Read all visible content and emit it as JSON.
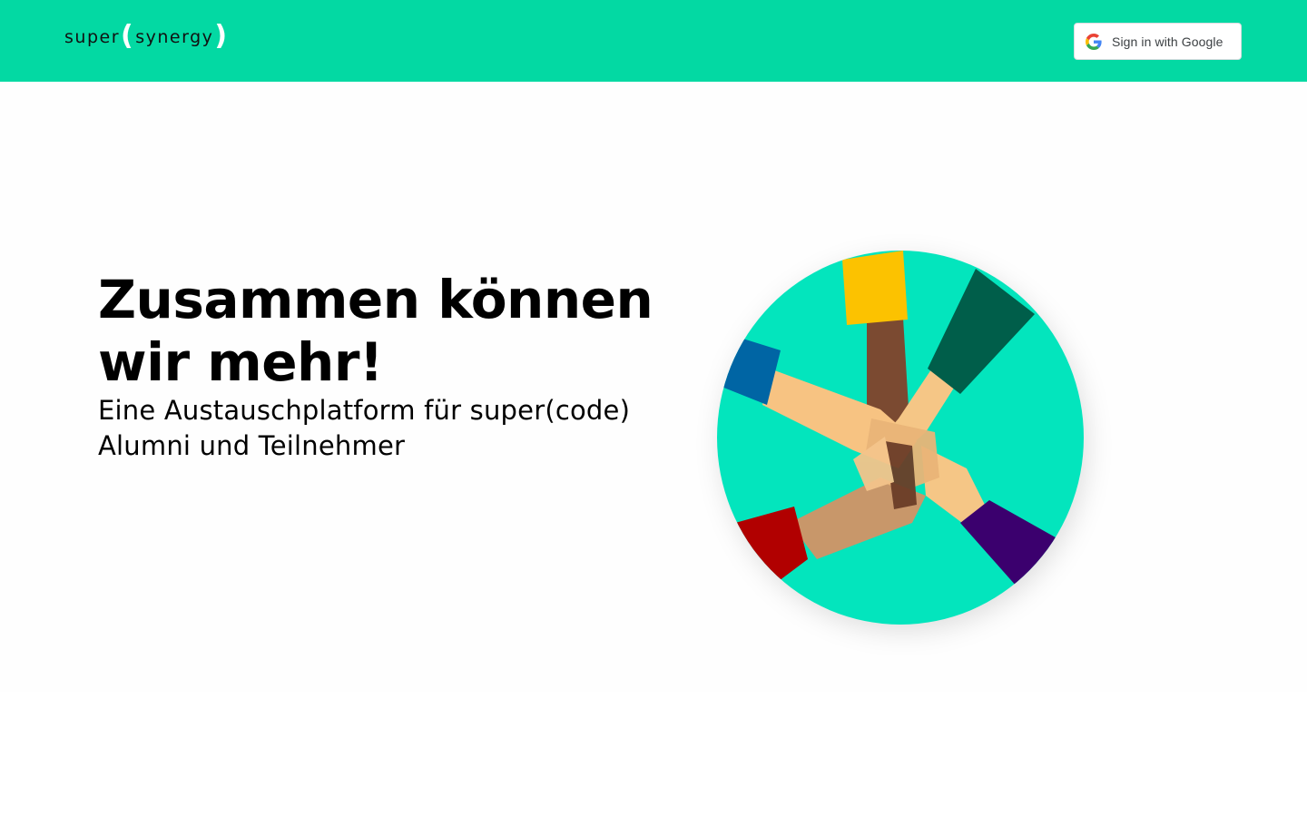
{
  "header": {
    "logo": {
      "part1": "super",
      "paren_open": "(",
      "part2": "synergy",
      "paren_close": ")"
    },
    "google_button": {
      "label": "Sign in with Google",
      "icon": "google-g-icon"
    },
    "background_color": "#03d9a3"
  },
  "hero": {
    "headline": "Zusammen können wir mehr!",
    "subline": "Eine Austauschplatform für super(code) Alumni und Teilnehmer",
    "illustration": "stacked-hands-illustration",
    "circle_color": "#03e5bd"
  }
}
